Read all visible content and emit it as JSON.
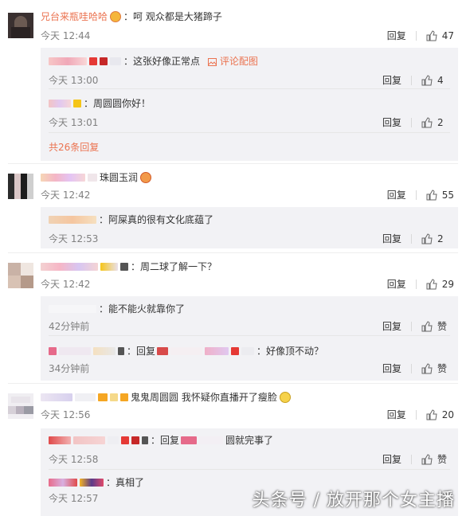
{
  "colors": {
    "accent": "#eb7350",
    "sub_bg": "#f2f2f5",
    "muted": "#808080"
  },
  "comments": [
    {
      "user": "兄台来瓶哇哈哈",
      "text": "：呵 观众都是大猪蹄子",
      "time": "今天 12:44",
      "reply_label": "回复",
      "likes": "47",
      "replies": [
        {
          "text": "：这张好像正常点",
          "image_link": "评论配图",
          "time": "今天 13:00",
          "reply_label": "回复",
          "likes": "4"
        },
        {
          "text": "：周圆圆你好！",
          "time": "今天 13:01",
          "reply_label": "回复",
          "likes": "2"
        }
      ],
      "more_replies": "共26条回复"
    },
    {
      "text": "珠圆玉润",
      "time": "今天 12:42",
      "reply_label": "回复",
      "likes": "55",
      "replies": [
        {
          "text": "：阿屎真的很有文化底蕴了",
          "time": "今天 12:53",
          "reply_label": "回复",
          "likes": "2"
        }
      ]
    },
    {
      "text": "：周二球了解一下？",
      "time": "今天 12:42",
      "reply_label": "回复",
      "likes": "29",
      "replies": [
        {
          "text": "：能不能火就靠你了",
          "time": "42分钟前",
          "reply_label": "回复",
          "likes": "赞"
        },
        {
          "text_a": "：回复",
          "text_b": "：好像顶不动？",
          "time": "34分钟前",
          "reply_label": "回复",
          "likes": "赞"
        }
      ]
    },
    {
      "text": "鬼鬼周圆圆 我怀疑你直播开了瘦脸",
      "time": "今天 12:56",
      "reply_label": "回复",
      "likes": "20",
      "replies": [
        {
          "text_a": "：回复",
          "text_b": "圆就完事了",
          "time": "今天 12:58",
          "reply_label": "回复",
          "likes": "赞"
        },
        {
          "text": "：真相了",
          "time": "今天 12:57"
        }
      ]
    }
  ],
  "watermark": "头条号 / 放开那个女主播",
  "icons": {
    "like": "thumb-up-icon",
    "image": "image-icon",
    "emoji": "emoji-icon"
  }
}
